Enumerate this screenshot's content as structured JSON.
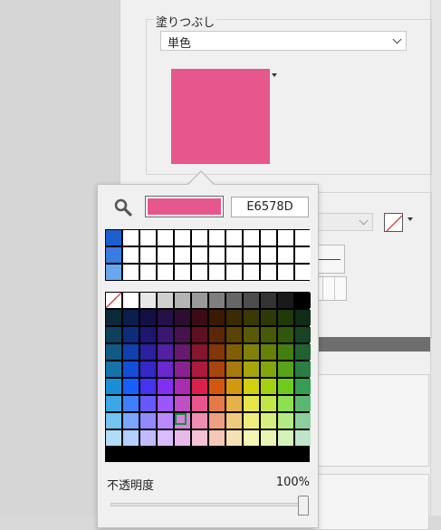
{
  "fill": {
    "label": "塗りつぶし",
    "type_value": "単色",
    "color_hex": "#E6578D"
  },
  "popup": {
    "search_icon": "search-icon",
    "hex_value": "E6578D",
    "current_color": "#E6578D",
    "recent_colors": [
      [
        "#1e5fd0",
        "#ffffff",
        "#ffffff",
        "#ffffff",
        "#ffffff",
        "#ffffff",
        "#ffffff",
        "#ffffff",
        "#ffffff",
        "#ffffff",
        "#ffffff",
        "#ffffff"
      ],
      [
        "#3a7de0",
        "#ffffff",
        "#ffffff",
        "#ffffff",
        "#ffffff",
        "#ffffff",
        "#ffffff",
        "#ffffff",
        "#ffffff",
        "#ffffff",
        "#ffffff",
        "#ffffff"
      ],
      [
        "#6aa6ee",
        "#ffffff",
        "#ffffff",
        "#ffffff",
        "#ffffff",
        "#ffffff",
        "#ffffff",
        "#ffffff",
        "#ffffff",
        "#ffffff",
        "#ffffff",
        "#ffffff"
      ]
    ],
    "palette": [
      [
        "none",
        "#ffffff",
        "#e8e8e8",
        "#cfcfcf",
        "#b4b4b4",
        "#9a9a9a",
        "#7f7f7f",
        "#666666",
        "#4d4d4d",
        "#333333",
        "#1a1a1a",
        "#000000"
      ],
      [
        "#0b2a3a",
        "#0a1f4e",
        "#150f47",
        "#25104a",
        "#2e0d32",
        "#3d0a17",
        "#3b1a05",
        "#3b2a04",
        "#3a3a04",
        "#2e3a05",
        "#203a08",
        "#0f2d16"
      ],
      [
        "#0e3f5c",
        "#0c2d7a",
        "#1e1770",
        "#3a1871",
        "#47124d",
        "#5e0f22",
        "#5c2607",
        "#5b4206",
        "#5a5a06",
        "#475a08",
        "#30580c",
        "#174423"
      ],
      [
        "#115a85",
        "#0f40ad",
        "#2a20a0",
        "#531fa3",
        "#661a6f",
        "#861530",
        "#833609",
        "#825e09",
        "#818109",
        "#668109",
        "#447f12",
        "#216233"
      ],
      [
        "#1573aa",
        "#124fd8",
        "#3428c8",
        "#6a28cd",
        "#8a2190",
        "#ad1a3d",
        "#a9450c",
        "#a8790b",
        "#a6a60b",
        "#84a60c",
        "#58a317",
        "#2a7e43"
      ],
      [
        "#188fd4",
        "#1760ff",
        "#4433f0",
        "#832ff3",
        "#a82bb0",
        "#d9214c",
        "#d4570f",
        "#d3980e",
        "#d0d00e",
        "#a5d00f",
        "#6fcc1d",
        "#359e53"
      ],
      [
        "#3ca7e6",
        "#3f7fff",
        "#6658ff",
        "#9d55ff",
        "#c04fc6",
        "#e6578d",
        "#e6794a",
        "#e6b04a",
        "#e6e64a",
        "#c1e64a",
        "#8fe04f",
        "#5bb872"
      ],
      [
        "#74c3f0",
        "#7aa6ff",
        "#9289ff",
        "#bb88ff",
        "#d584d8",
        "#ee8eb0",
        "#ee9f7f",
        "#eecb7f",
        "#eeee7f",
        "#d6ee7f",
        "#b3ea84",
        "#8ccf9c"
      ],
      [
        "#b0dcf7",
        "#b4ceff",
        "#c1bbff",
        "#d9bbff",
        "#e7b9e9",
        "#f5c1d4",
        "#f5c7b4",
        "#f5e2b4",
        "#f5f5b4",
        "#e8f5b4",
        "#d5f3b7",
        "#c0e4c8"
      ]
    ],
    "opacity_label": "不透明度",
    "opacity_value": "100%",
    "opacity_level": 1.0
  }
}
